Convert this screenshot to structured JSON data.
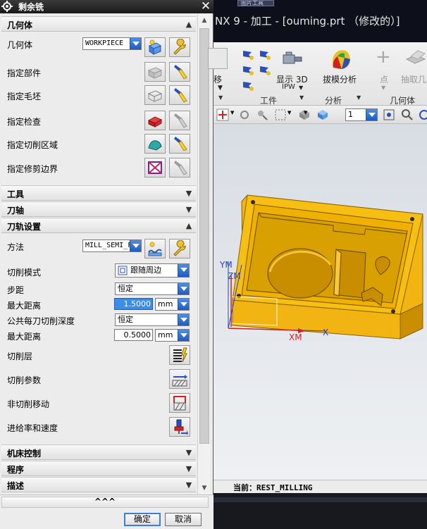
{
  "dialog": {
    "title": "剩余铣",
    "close_label": "✕",
    "sections": {
      "geometry": "几何体",
      "tools": "工具",
      "tool_axis": "刀轴",
      "path_settings": "刀轨设置",
      "machine_control": "机床控制",
      "program": "程序",
      "description": "描述"
    },
    "geometry": {
      "geometry_label": "几何体",
      "geometry_value": "WORKPIECE",
      "specify_part": "指定部件",
      "specify_blank": "指定毛坯",
      "specify_check": "指定检查",
      "specify_cut_area": "指定切削区域",
      "specify_trim_boundary": "指定修剪边界"
    },
    "path": {
      "method_label": "方法",
      "method_value": "MILL_SEMI_FINISH",
      "cut_mode_label": "切削模式",
      "cut_mode_value": "跟随周边",
      "stepover_label": "步距",
      "stepover_value": "恒定",
      "max_distance_label": "最大距离",
      "max_distance_value": "1.5000",
      "max_distance_unit": "mm",
      "common_depth_label": "公共每刀切削深度",
      "common_depth_value": "恒定",
      "max_distance2_label": "最大距离",
      "max_distance2_value": "0.5000",
      "max_distance2_unit": "mm",
      "cut_levels_label": "切削层",
      "cut_params_label": "切削参数",
      "non_cut_moves_label": "非切削移动",
      "feeds_speeds_label": "进给率和速度"
    },
    "collapse_label": "^^^",
    "ok_label": "确定",
    "cancel_label": "取消"
  },
  "nx": {
    "tab_label": "图片工具",
    "window_title": "NX 9 - 加工 - [ouming.prt （修改的）]",
    "ribbon": {
      "move_label": "移",
      "display_3d_label": "显示 3D",
      "ipw_label": "IPW",
      "draft_analysis_label": "拔模分析",
      "point_label": "点",
      "extract_label": "抽取几",
      "group_workpiece": "工件",
      "group_analysis": "分析",
      "group_geometry": "几何体"
    },
    "toolbar": {
      "layer_value": "1"
    },
    "axes": {
      "zm": "ZM",
      "ym": "YM",
      "xm": "XM",
      "x": "X"
    },
    "status": {
      "current_label": "当前：REST_MILLING"
    }
  }
}
